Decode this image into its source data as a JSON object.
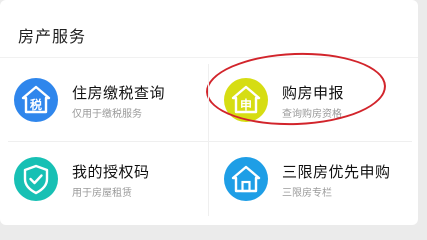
{
  "section": {
    "title": "房产服务"
  },
  "tiles": [
    {
      "title": "住房缴税查询",
      "subtitle": "仅用于缴税服务",
      "icon": "tax-house-icon",
      "icon_color": "#2f86ec",
      "badge": "税"
    },
    {
      "title": "购房申报",
      "subtitle": "查询购房资格",
      "icon": "apply-house-icon",
      "icon_color": "#d6dd13",
      "badge": "申"
    },
    {
      "title": "我的授权码",
      "subtitle": "用于房屋租赁",
      "icon": "shield-check-icon",
      "icon_color": "#17c0b4"
    },
    {
      "title": "三限房优先申购",
      "subtitle": "三限房专栏",
      "icon": "home-icon",
      "icon_color": "#1e9ee6"
    }
  ],
  "highlight_color": "#d2242b"
}
